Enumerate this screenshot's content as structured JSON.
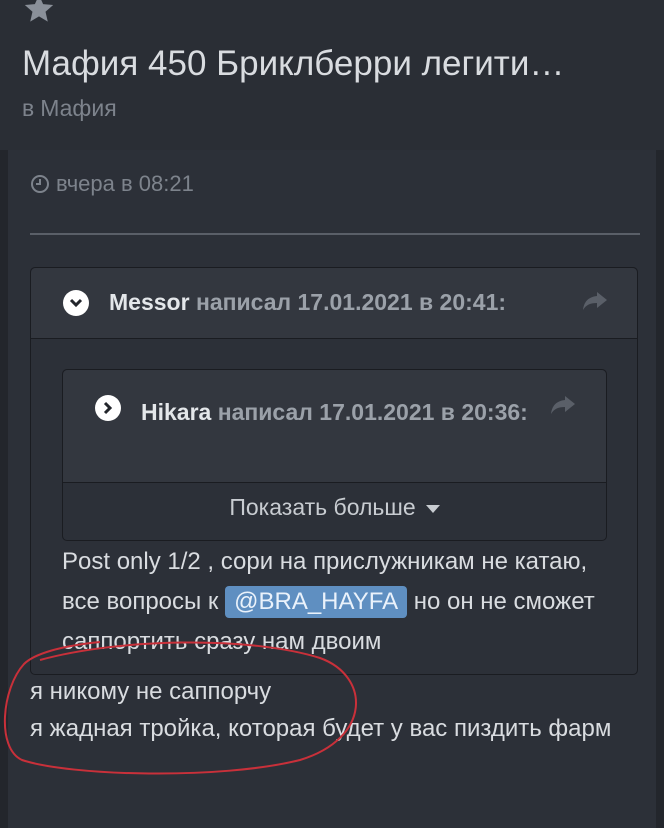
{
  "thread": {
    "title": "Мафия 450 Бриклберри легити…",
    "forum_prefix": "в",
    "forum_name": "Мафия"
  },
  "post": {
    "time": "вчера в 08:21",
    "quote_outer": {
      "author": "Messor",
      "meta": "написал 17.01.2021 в 20:41:"
    },
    "quote_inner": {
      "author": "Hikara",
      "meta": "написал 17.01.2021 в 20:36:",
      "show_more": "Показать больше"
    },
    "quoted_text_1": "Post only 1/2 , сори на прислужникам не катаю, все вопросы к",
    "mention": "@BRA_HAYFA",
    "quoted_text_2": "но он не сможет саппортить сразу нам двоим",
    "reply_line_1": "я никому не саппорчу",
    "reply_line_2": "я жадная тройка, которая будет у вас пиздить фарм"
  },
  "colors": {
    "background": "#23262c",
    "header": "#2a2e35",
    "mention": "#5f8fc1",
    "annotation": "#c9303a"
  },
  "icons": [
    "star-icon",
    "clock-icon",
    "chevron-down-icon",
    "chevron-right-icon",
    "share-icon",
    "caret-down-icon"
  ]
}
